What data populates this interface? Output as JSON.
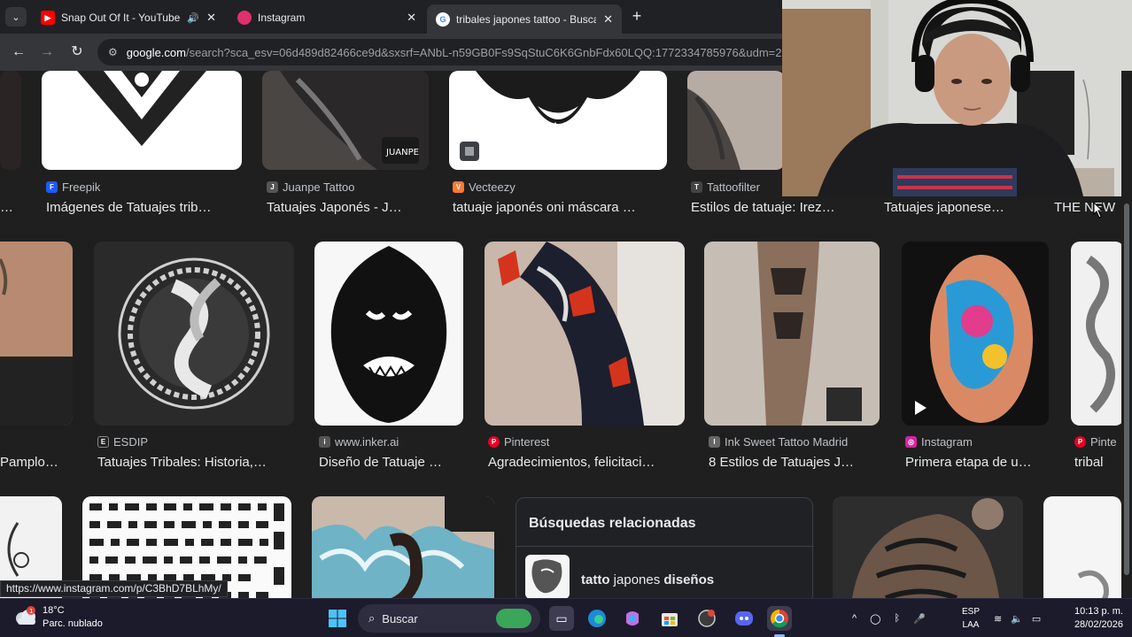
{
  "browser": {
    "tabs": [
      {
        "title": "Snap Out Of It - YouTube",
        "favicon": "youtube-icon",
        "color": "#ff0000"
      },
      {
        "title": "Instagram",
        "favicon": "instagram-icon",
        "color": "#e1306c"
      },
      {
        "title": "tribales japones tattoo - Buscar",
        "favicon": "google-icon",
        "color": "#4285f4"
      }
    ],
    "address_host": "google.com",
    "address_path": "/search?sca_esv=06d489d82466ce9d&sxsrf=ANbL-n59GB0Fs9SqStuC6K6GnbFdx60LQQ:1772334785976&udm=2&"
  },
  "results": {
    "row1": [
      {
        "source": "Freepik",
        "caption": "Imágenes de Tatuajes trib…",
        "src_color": "#1a5cff"
      },
      {
        "source": "Juanpe Tattoo",
        "caption": "Tatuajes Japonés - J…",
        "src_color": "#555555"
      },
      {
        "source": "Vecteezy",
        "caption": "tatuaje japonés oni máscara …",
        "src_color": "#ff7a2f"
      },
      {
        "source": "Tattoofilter",
        "caption": "Estilos de tatuaje: Irez…",
        "src_color": "#444444"
      },
      {
        "source": "",
        "caption": "Tatuajes japonese…",
        "src_color": "#444444"
      },
      {
        "source": "",
        "caption": "THE NEW",
        "src_color": "#444444"
      }
    ],
    "row2": [
      {
        "source": "",
        "caption": "Pamplo…",
        "src_color": "#444444"
      },
      {
        "source": "ESDIP",
        "caption": "Tatuajes Tribales: Historia,…",
        "src_color": "#222222"
      },
      {
        "source": "www.inker.ai",
        "caption": "Diseño de Tatuaje …",
        "src_color": "#555555"
      },
      {
        "source": "Pinterest",
        "caption": "Agradecimientos, felicitaci…",
        "src_color": "#e60023"
      },
      {
        "source": "Ink Sweet Tattoo Madrid",
        "caption": "8 Estilos de Tatuajes J…",
        "src_color": "#666666"
      },
      {
        "source": "Instagram",
        "caption": "Primera etapa de u…",
        "src_color": "#d6249f"
      },
      {
        "source": "Pinte",
        "caption": "tribal",
        "src_color": "#e60023"
      }
    ],
    "related": {
      "heading": "Búsquedas relacionadas",
      "query_plain_1": "tatto",
      "query_plain_2": "japones",
      "query_bold": "diseños"
    }
  },
  "status_url": "https://www.instagram.com/p/C3BhD7BLhMy/",
  "taskbar": {
    "temp": "18°C",
    "weather": "Parc. nublado",
    "search_placeholder": "Buscar",
    "lang_1": "ESP",
    "lang_2": "LAA",
    "time": "10:13 p. m.",
    "date": "28/02/2026"
  }
}
